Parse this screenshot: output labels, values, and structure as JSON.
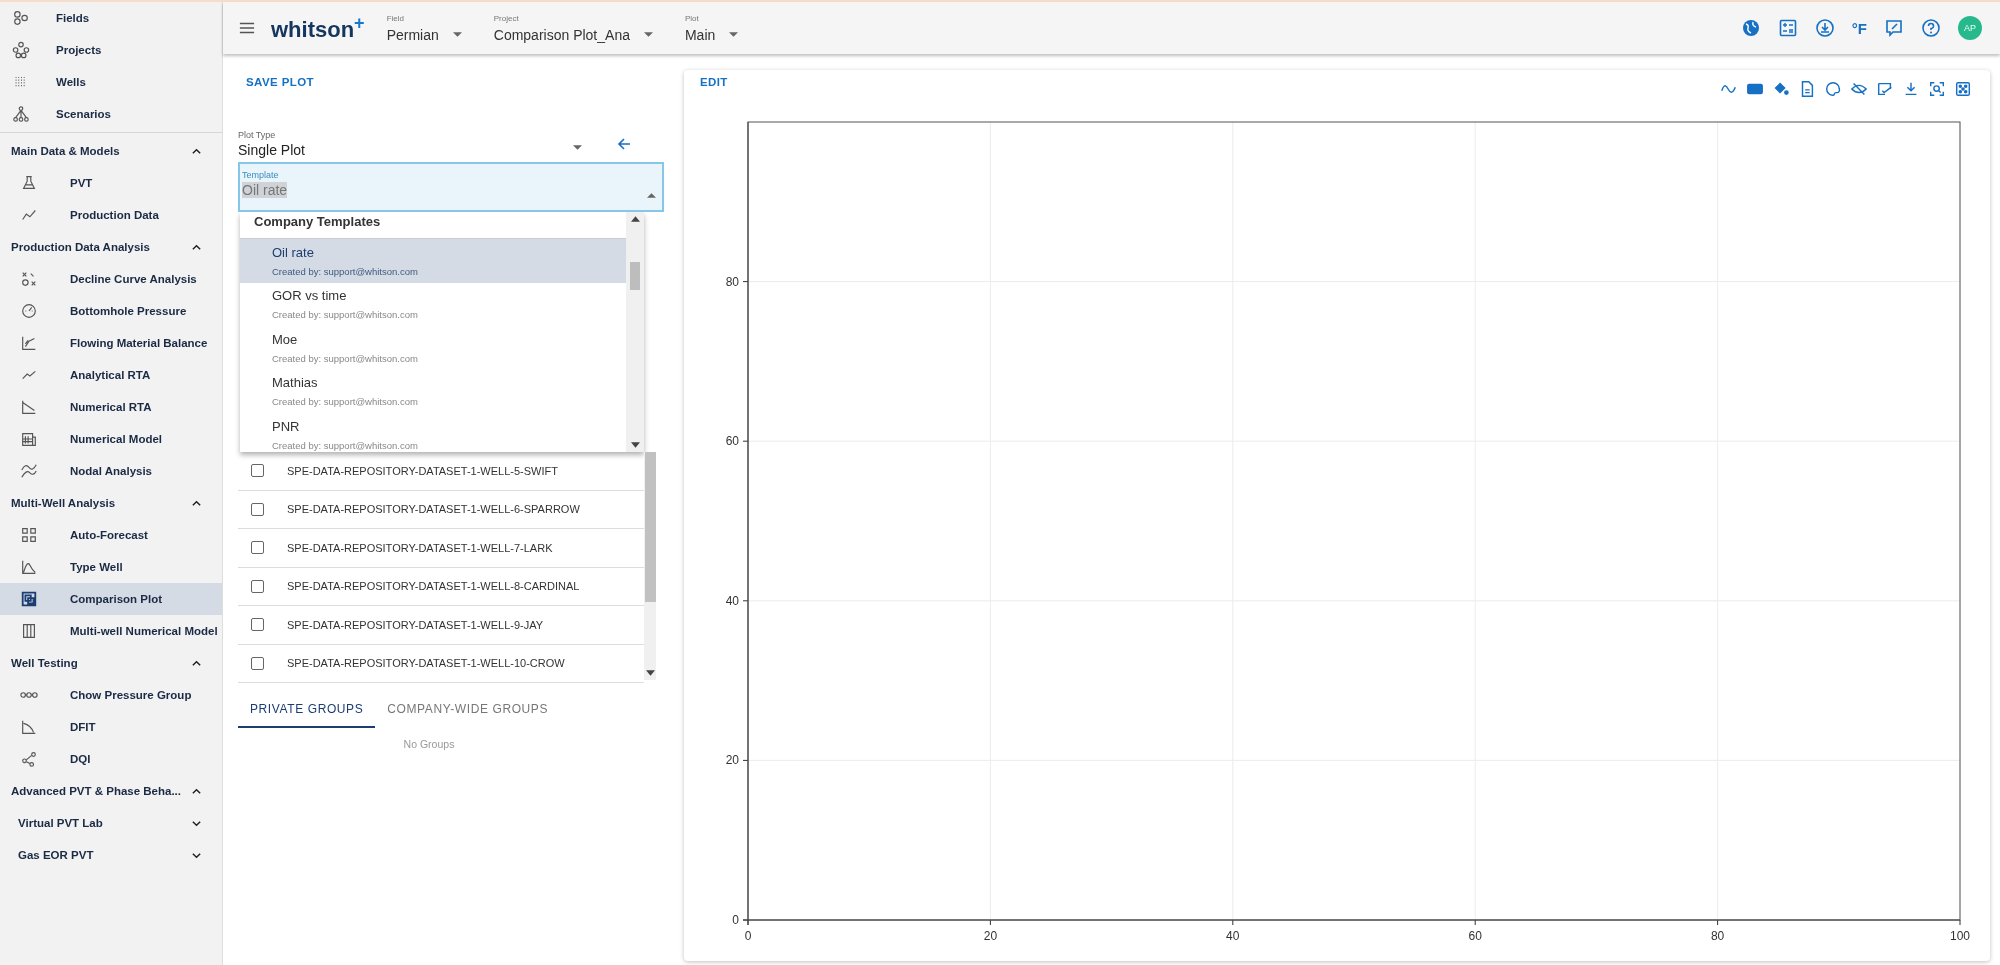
{
  "sidebar": {
    "nav": [
      {
        "label": "Fields"
      },
      {
        "label": "Projects"
      },
      {
        "label": "Wells"
      },
      {
        "label": "Scenarios"
      }
    ],
    "sections": [
      {
        "title": "Main Data & Models",
        "expanded": true,
        "items": [
          {
            "kind": "link",
            "label": "PVT",
            "selected": false
          },
          {
            "kind": "link",
            "label": "Production Data",
            "selected": false
          }
        ]
      },
      {
        "title": "Production Data Analysis",
        "expanded": true,
        "items": [
          {
            "kind": "link",
            "label": "Decline Curve Analysis",
            "selected": false
          },
          {
            "kind": "link",
            "label": "Bottomhole Pressure",
            "selected": false
          },
          {
            "kind": "link",
            "label": "Flowing Material Balance",
            "selected": false
          },
          {
            "kind": "link",
            "label": "Analytical RTA",
            "selected": false
          },
          {
            "kind": "link",
            "label": "Numerical RTA",
            "selected": false
          },
          {
            "kind": "link",
            "label": "Numerical Model",
            "selected": false
          },
          {
            "kind": "link",
            "label": "Nodal Analysis",
            "selected": false
          }
        ]
      },
      {
        "title": "Multi-Well Analysis",
        "expanded": true,
        "items": [
          {
            "kind": "link",
            "label": "Auto-Forecast",
            "selected": false
          },
          {
            "kind": "link",
            "label": "Type Well",
            "selected": false
          },
          {
            "kind": "link",
            "label": "Comparison Plot",
            "selected": true
          },
          {
            "kind": "link",
            "label": "Multi-well Numerical Model",
            "selected": false
          }
        ]
      },
      {
        "title": "Well Testing",
        "expanded": true,
        "items": [
          {
            "kind": "link",
            "label": "Chow Pressure Group",
            "selected": false
          },
          {
            "kind": "link",
            "label": "DFIT",
            "selected": false
          },
          {
            "kind": "link",
            "label": "DQI",
            "selected": false
          }
        ]
      },
      {
        "title": "Advanced PVT & Phase Beha...",
        "expanded": true,
        "items": [
          {
            "kind": "group",
            "label": "Virtual PVT Lab",
            "expanded": false
          },
          {
            "kind": "group",
            "label": "Gas EOR PVT",
            "expanded": false
          }
        ]
      }
    ]
  },
  "top_bar": {
    "logo": {
      "text": "whitson",
      "mark": "+"
    },
    "selectors": [
      {
        "label": "Field",
        "value": "Permian"
      },
      {
        "label": "Project",
        "value": "Comparison Plot_Ana"
      },
      {
        "label": "Plot",
        "value": "Main"
      }
    ],
    "unit_label": "°F",
    "avatar": "AP"
  },
  "settings_panel": {
    "save_button": "SAVE PLOT",
    "plot_type": {
      "label": "Plot Type",
      "value": "Single Plot"
    },
    "template": {
      "label": "Template",
      "value": "Oil rate",
      "expanded": true
    },
    "template_menu": {
      "group": "Company Templates",
      "options": [
        {
          "name": "Oil rate",
          "creator": "Created by: support@whitson.com",
          "selected": true
        },
        {
          "name": "GOR vs time",
          "creator": "Created by: support@whitson.com",
          "selected": false
        },
        {
          "name": "Moe",
          "creator": "Created by: support@whitson.com",
          "selected": false
        },
        {
          "name": "Mathias",
          "creator": "Created by: support@whitson.com",
          "selected": false
        },
        {
          "name": "PNR",
          "creator": "Created by: support@whitson.com",
          "selected": false
        }
      ]
    },
    "wells": [
      {
        "name": "SPE-DATA-REPOSITORY-DATASET-1-WELL-5-SWIFT",
        "checked": false
      },
      {
        "name": "SPE-DATA-REPOSITORY-DATASET-1-WELL-6-SPARROW",
        "checked": false
      },
      {
        "name": "SPE-DATA-REPOSITORY-DATASET-1-WELL-7-LARK",
        "checked": false
      },
      {
        "name": "SPE-DATA-REPOSITORY-DATASET-1-WELL-8-CARDINAL",
        "checked": false
      },
      {
        "name": "SPE-DATA-REPOSITORY-DATASET-1-WELL-9-JAY",
        "checked": false
      },
      {
        "name": "SPE-DATA-REPOSITORY-DATASET-1-WELL-10-CROW",
        "checked": false
      }
    ],
    "group_tabs": [
      {
        "label": "PRIVATE GROUPS",
        "selected": true
      },
      {
        "label": "COMPANY-WIDE GROUPS",
        "selected": false
      }
    ],
    "empty_message": "No Groups"
  },
  "plot_panel": {
    "edit_button": "EDIT",
    "chart_data": {
      "type": "line",
      "xlim": [
        0,
        100
      ],
      "ylim": [
        0,
        100
      ],
      "xticks": [
        0,
        20,
        40,
        60,
        80,
        100
      ],
      "yticks": [
        0,
        20,
        40,
        60,
        80
      ],
      "grid": true
    }
  }
}
